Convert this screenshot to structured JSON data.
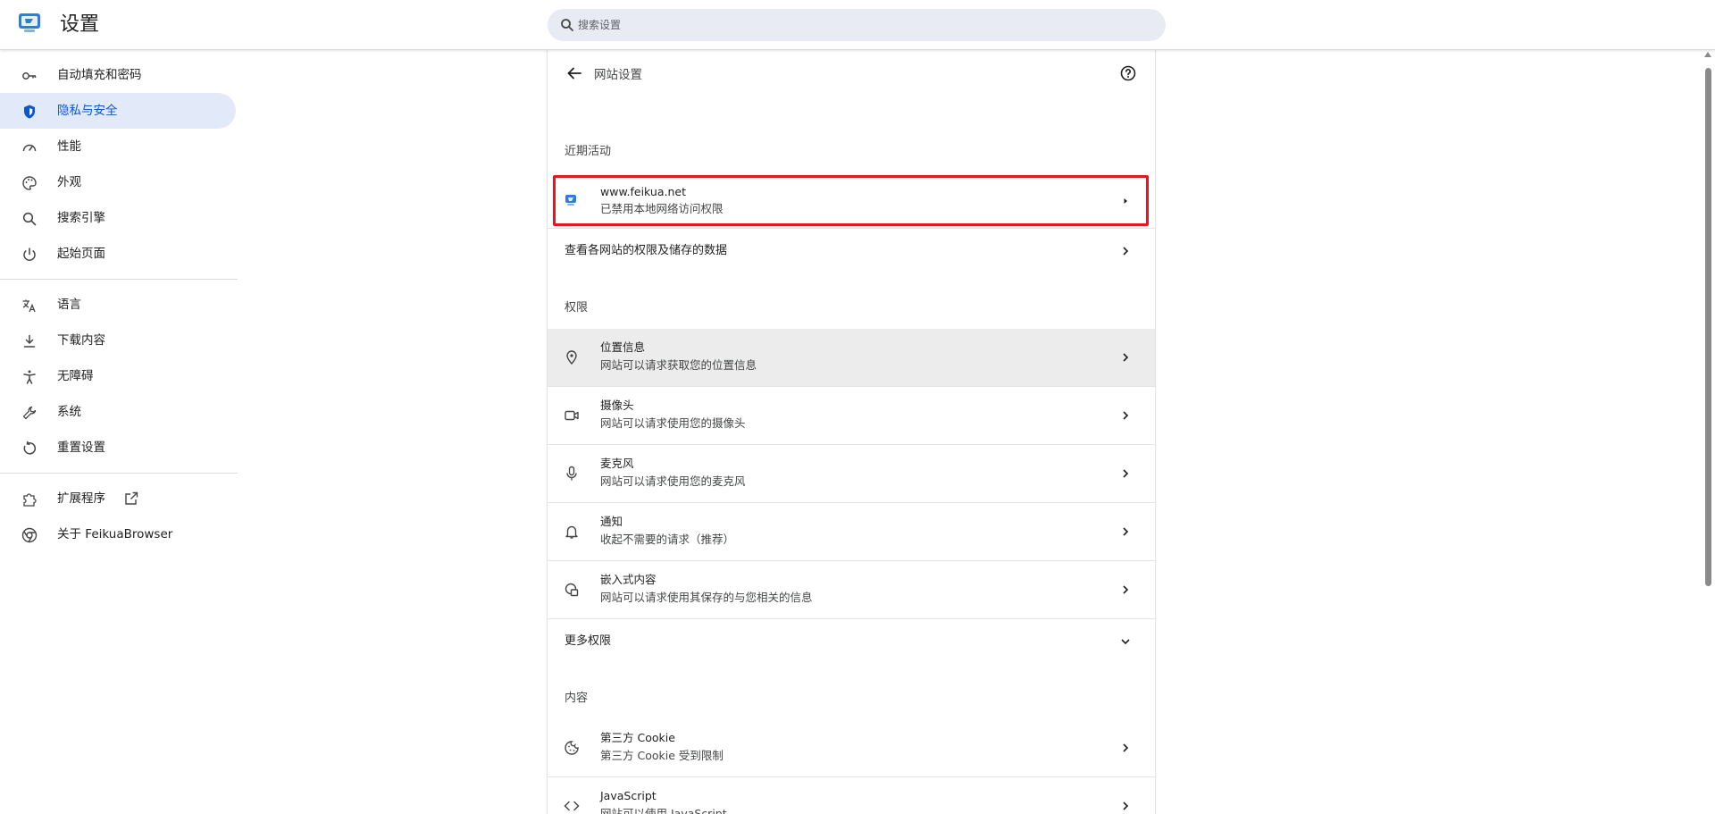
{
  "app": {
    "title": "设置"
  },
  "search": {
    "placeholder": "搜索设置"
  },
  "sidebar": {
    "items": [
      {
        "label": "自动填充和密码",
        "icon": "key-icon"
      },
      {
        "label": "隐私与安全",
        "icon": "shield-icon",
        "active": true
      },
      {
        "label": "性能",
        "icon": "speedometer-icon"
      },
      {
        "label": "外观",
        "icon": "palette-icon"
      },
      {
        "label": "搜索引擎",
        "icon": "search-icon"
      },
      {
        "label": "起始页面",
        "icon": "power-icon"
      },
      {
        "label": "语言",
        "icon": "translate-icon"
      },
      {
        "label": "下载内容",
        "icon": "download-icon"
      },
      {
        "label": "无障碍",
        "icon": "accessibility-icon"
      },
      {
        "label": "系统",
        "icon": "wrench-icon"
      },
      {
        "label": "重置设置",
        "icon": "reset-icon"
      },
      {
        "label": "扩展程序",
        "icon": "puzzle-icon"
      },
      {
        "label": "关于 FeikuaBrowser",
        "icon": "browser-logo-icon"
      }
    ]
  },
  "main": {
    "page_title": "网站设置",
    "recent": {
      "section_title": "近期活动",
      "site": {
        "title": "www.feikua.net",
        "subtitle": "已禁用本地网络访问权限"
      }
    },
    "view_all_label": "查看各网站的权限及储存的数据",
    "permissions": {
      "section_title": "权限",
      "items": [
        {
          "title": "位置信息",
          "subtitle": "网站可以请求获取您的位置信息",
          "icon": "location-pin-icon"
        },
        {
          "title": "摄像头",
          "subtitle": "网站可以请求使用您的摄像头",
          "icon": "camera-icon"
        },
        {
          "title": "麦克风",
          "subtitle": "网站可以请求使用您的麦克风",
          "icon": "microphone-icon"
        },
        {
          "title": "通知",
          "subtitle": "收起不需要的请求（推荐）",
          "icon": "bell-icon"
        },
        {
          "title": "嵌入式内容",
          "subtitle": "网站可以请求使用其保存的与您相关的信息",
          "icon": "embedded-content-icon"
        }
      ],
      "more_label": "更多权限"
    },
    "content": {
      "section_title": "内容",
      "items": [
        {
          "title": "第三方 Cookie",
          "subtitle": "第三方 Cookie 受到限制",
          "icon": "cookie-icon"
        },
        {
          "title": "JavaScript",
          "subtitle": "网站可以使用 JavaScript",
          "icon": "code-icon"
        }
      ]
    }
  },
  "colors": {
    "accent": "#0b57d0",
    "active_bg": "#e2e9f9",
    "highlight": "#e1191e",
    "search_bg": "#e8eaf4"
  }
}
